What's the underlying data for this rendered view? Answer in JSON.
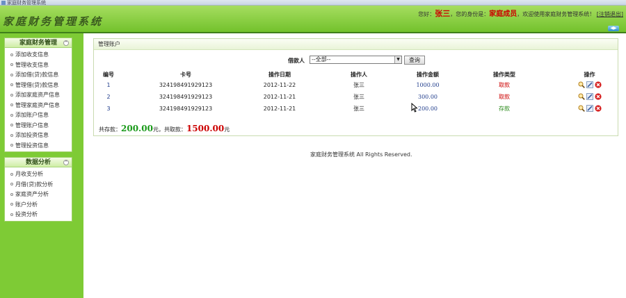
{
  "window": {
    "title": "家庭财务管理系统"
  },
  "header": {
    "logo": "家庭财务管理系统",
    "greeting_prefix": "您好：",
    "user_name": "张三",
    "identity_prefix": "，您的身份是：",
    "user_role": "家庭成员",
    "welcome_text": "，欢迎使用家庭财务管理系统！",
    "logout_label": "[注销退出]"
  },
  "sidebar": {
    "sections": [
      {
        "title": "家庭财务管理",
        "items": [
          {
            "label": "添加收支信息"
          },
          {
            "label": "管理收支信息"
          },
          {
            "label": "添加借(贷)款信息"
          },
          {
            "label": "管理借(贷)款信息"
          },
          {
            "label": "添加家庭资产信息"
          },
          {
            "label": "管理家庭资产信息"
          },
          {
            "label": "添加账户信息"
          },
          {
            "label": "管理账户信息"
          },
          {
            "label": "添加投资信息"
          },
          {
            "label": "管理投资信息"
          }
        ]
      },
      {
        "title": "数据分析",
        "items": [
          {
            "label": "月收支分析"
          },
          {
            "label": "月借(贷)款分析"
          },
          {
            "label": "家庭资产分析"
          },
          {
            "label": "账户分析"
          },
          {
            "label": "投资分析"
          }
        ]
      }
    ]
  },
  "main": {
    "panel_title": "管理账户",
    "search": {
      "label": "借款人",
      "selected_option": "--全部--",
      "button_label": "查询"
    },
    "table": {
      "headers": [
        "编号",
        "卡号",
        "操作日期",
        "操作人",
        "操作金额",
        "操作类型",
        "操作"
      ],
      "rows": [
        {
          "id": "1",
          "card": "324198491929123",
          "date": "2012-11-22",
          "operator": "张三",
          "amount": "1000.00",
          "type": "取款",
          "type_kind": "take"
        },
        {
          "id": "2",
          "card": "324198491929123",
          "date": "2012-11-21",
          "operator": "张三",
          "amount": "300.00",
          "type": "取款",
          "type_kind": "take"
        },
        {
          "id": "3",
          "card": "324198491929123",
          "date": "2012-11-21",
          "operator": "张三",
          "amount": "200.00",
          "type": "存款",
          "type_kind": "save"
        }
      ],
      "row_actions": [
        "view-icon",
        "edit-icon",
        "delete-icon"
      ]
    },
    "summary": {
      "save_prefix": "共存款：",
      "save_amount": "200.00",
      "save_unit": "元，",
      "take_prefix": "共取款：",
      "take_amount": "1500.00",
      "take_unit": "元"
    }
  },
  "footer": {
    "text": "家庭财务管理系统 All Rights Reserved."
  },
  "colors": {
    "header_green": "#8fd14a",
    "sidebar_green": "#7ecb35",
    "take_red": "#cc0000",
    "save_green": "#2a8a1a"
  }
}
